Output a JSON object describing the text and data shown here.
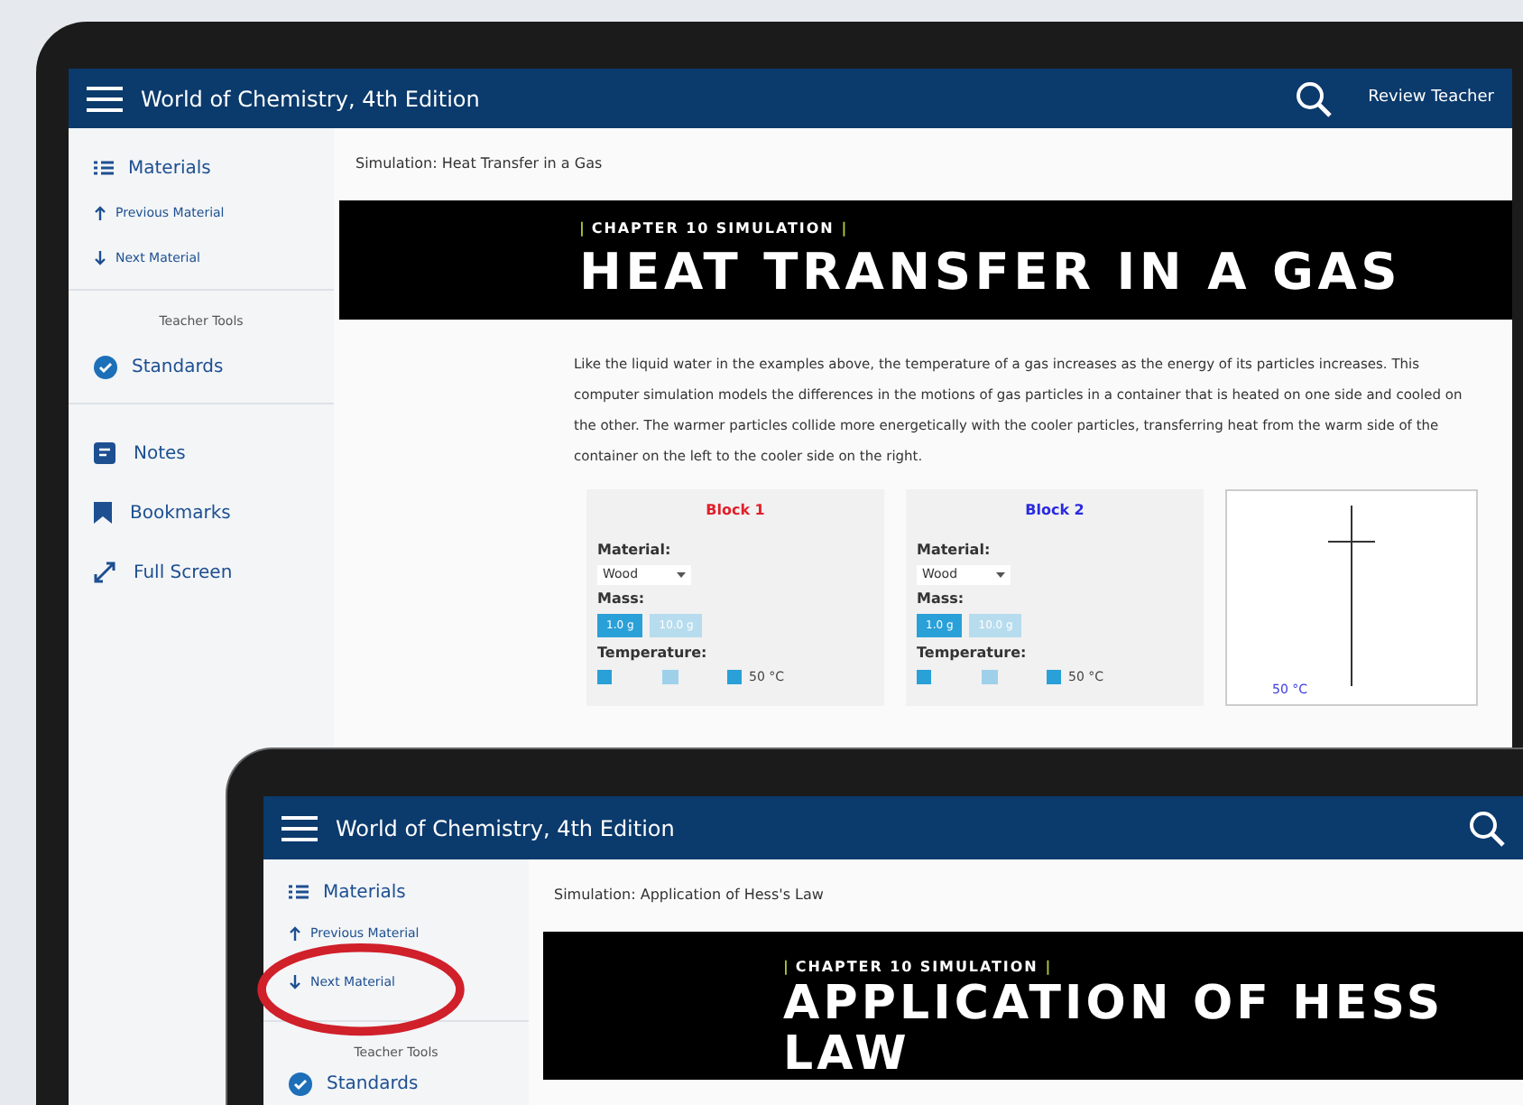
{
  "tablets": [
    {
      "header": {
        "title": "World of Chemistry, 4th Edition",
        "account": "Review Teacher"
      },
      "sidebar": {
        "materials": "Materials",
        "previous": "Previous Material",
        "next": "Next Material",
        "tools_heading": "Teacher Tools",
        "standards": "Standards",
        "tools": [
          "Notes",
          "Bookmarks",
          "Full Screen"
        ]
      },
      "breadcrumb": "Simulation: Heat Transfer in a Gas",
      "banner": {
        "kicker_left": "|",
        "kicker": "CHAPTER 10 SIMULATION",
        "kicker_right": "|",
        "title_lines": [
          "HEAT TRANSFER IN A GAS"
        ]
      },
      "paragraph": "Like the liquid water in the examples above, the temperature of a gas increases as the energy of its particles increases. This computer simulation models the differences in the motions of gas particles in a container that is heated on one side and cooled on the other. The warmer particles collide more energetically with the cooler particles, transferring heat from the warm side of the container on the left to the cooler side on the right.",
      "simulation": {
        "blocks": [
          {
            "name": "Block 1",
            "color": "#e0202a",
            "material_label": "Material:",
            "material": "Wood",
            "mass_label": "Mass:",
            "mass_options": [
              {
                "label": "1.0 g",
                "selected": true
              },
              {
                "label": "10.0 g",
                "selected": false
              }
            ],
            "temperature_label": "Temperature:",
            "level": 0.5,
            "temperature": "50 °C"
          },
          {
            "name": "Block 2",
            "color": "#2a2ae0",
            "material_label": "Material:",
            "material": "Wood",
            "mass_label": "Mass:",
            "mass_options": [
              {
                "label": "1.0 g",
                "selected": true
              },
              {
                "label": "10.0 g",
                "selected": false
              }
            ],
            "temperature_label": "Temperature:",
            "level": 0.5,
            "temperature": "50 °C"
          }
        ],
        "graph_reading": "50 °C"
      }
    },
    {
      "header": {
        "title": "World of Chemistry, 4th Edition"
      },
      "sidebar": {
        "materials": "Materials",
        "previous": "Previous Material",
        "next": "Next Material",
        "tools_heading": "Teacher Tools",
        "standards": "Standards"
      },
      "breadcrumb": "Simulation: Application of Hess's Law",
      "banner": {
        "kicker_left": "|",
        "kicker": "CHAPTER 10 SIMULATION",
        "kicker_right": "|",
        "title_lines": [
          "APPLICATION OF HESS",
          "LAW"
        ]
      }
    }
  ]
}
